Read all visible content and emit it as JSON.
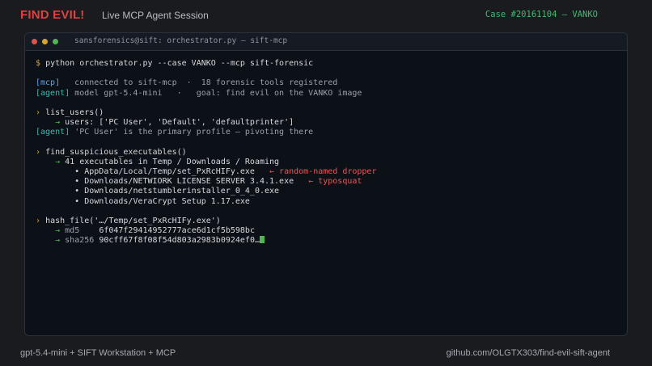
{
  "header": {
    "brand": "FIND EVIL!",
    "session": "Live MCP Agent Session",
    "case": "Case #20161104 — VANKO"
  },
  "terminal": {
    "title": "sansforensics@sift: orchestrator.py — sift-mcp",
    "command_prompt": "$",
    "command": "python orchestrator.py --case VANKO --mcp sift-forensic",
    "mcp_tag": "[mcp]",
    "mcp_status": "connected to sift-mcp  ·  18 forensic tools registered",
    "agent_tag": "[agent]",
    "agent_status": "model gpt-5.4-mini   ·   goal: find evil on the VANKO image",
    "step1_call": "list_users()",
    "step1_result": "users: ['PC User', 'Default', 'defaultprinter']",
    "step1_agent": "'PC User' is the primary profile — pivoting there",
    "step2_call": "find_suspicious_executables()",
    "step2_result": "41 executables in Temp / Downloads / Roaming",
    "step2_items": [
      {
        "path": "AppData/Local/Temp/set_PxRcHIFy.exe",
        "note": "← random-named dropper"
      },
      {
        "path": "Downloads/NETWIORK LICENSE SERVER 3.4.1.exe",
        "note": "← typosquat"
      },
      {
        "path": "Downloads/netstumblerinstaller_0_4_0.exe",
        "note": ""
      },
      {
        "path": "Downloads/VeraCrypt Setup 1.17.exe",
        "note": ""
      }
    ],
    "step3_call": "hash_file('…/Temp/set_PxRcHIFy.exe')",
    "md5_label": "md5",
    "md5_value": "6f047f29414952777ace6d1cf5b598bc",
    "sha256_label": "sha256",
    "sha256_value": "90cff67f8f08f54d803a2983b0924ef0…",
    "chevron": "›",
    "arrow": "→",
    "bullet": "•"
  },
  "footer": {
    "left": "gpt-5.4-mini  +  SIFT Workstation  +  MCP",
    "right": "github.com/OLGTX303/find-evil-sift-agent"
  }
}
